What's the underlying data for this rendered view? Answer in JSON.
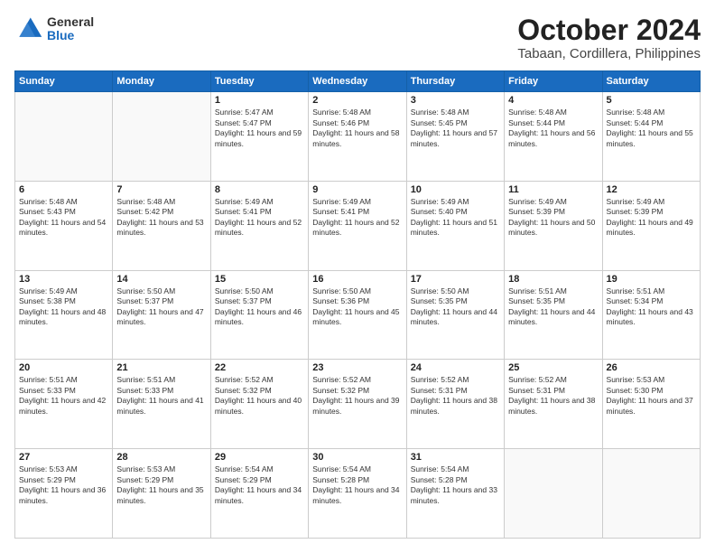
{
  "header": {
    "logo_general": "General",
    "logo_blue": "Blue",
    "month": "October 2024",
    "location": "Tabaan, Cordillera, Philippines"
  },
  "weekdays": [
    "Sunday",
    "Monday",
    "Tuesday",
    "Wednesday",
    "Thursday",
    "Friday",
    "Saturday"
  ],
  "weeks": [
    [
      {
        "day": "",
        "info": ""
      },
      {
        "day": "",
        "info": ""
      },
      {
        "day": "1",
        "info": "Sunrise: 5:47 AM\nSunset: 5:47 PM\nDaylight: 11 hours and 59 minutes."
      },
      {
        "day": "2",
        "info": "Sunrise: 5:48 AM\nSunset: 5:46 PM\nDaylight: 11 hours and 58 minutes."
      },
      {
        "day": "3",
        "info": "Sunrise: 5:48 AM\nSunset: 5:45 PM\nDaylight: 11 hours and 57 minutes."
      },
      {
        "day": "4",
        "info": "Sunrise: 5:48 AM\nSunset: 5:44 PM\nDaylight: 11 hours and 56 minutes."
      },
      {
        "day": "5",
        "info": "Sunrise: 5:48 AM\nSunset: 5:44 PM\nDaylight: 11 hours and 55 minutes."
      }
    ],
    [
      {
        "day": "6",
        "info": "Sunrise: 5:48 AM\nSunset: 5:43 PM\nDaylight: 11 hours and 54 minutes."
      },
      {
        "day": "7",
        "info": "Sunrise: 5:48 AM\nSunset: 5:42 PM\nDaylight: 11 hours and 53 minutes."
      },
      {
        "day": "8",
        "info": "Sunrise: 5:49 AM\nSunset: 5:41 PM\nDaylight: 11 hours and 52 minutes."
      },
      {
        "day": "9",
        "info": "Sunrise: 5:49 AM\nSunset: 5:41 PM\nDaylight: 11 hours and 52 minutes."
      },
      {
        "day": "10",
        "info": "Sunrise: 5:49 AM\nSunset: 5:40 PM\nDaylight: 11 hours and 51 minutes."
      },
      {
        "day": "11",
        "info": "Sunrise: 5:49 AM\nSunset: 5:39 PM\nDaylight: 11 hours and 50 minutes."
      },
      {
        "day": "12",
        "info": "Sunrise: 5:49 AM\nSunset: 5:39 PM\nDaylight: 11 hours and 49 minutes."
      }
    ],
    [
      {
        "day": "13",
        "info": "Sunrise: 5:49 AM\nSunset: 5:38 PM\nDaylight: 11 hours and 48 minutes."
      },
      {
        "day": "14",
        "info": "Sunrise: 5:50 AM\nSunset: 5:37 PM\nDaylight: 11 hours and 47 minutes."
      },
      {
        "day": "15",
        "info": "Sunrise: 5:50 AM\nSunset: 5:37 PM\nDaylight: 11 hours and 46 minutes."
      },
      {
        "day": "16",
        "info": "Sunrise: 5:50 AM\nSunset: 5:36 PM\nDaylight: 11 hours and 45 minutes."
      },
      {
        "day": "17",
        "info": "Sunrise: 5:50 AM\nSunset: 5:35 PM\nDaylight: 11 hours and 44 minutes."
      },
      {
        "day": "18",
        "info": "Sunrise: 5:51 AM\nSunset: 5:35 PM\nDaylight: 11 hours and 44 minutes."
      },
      {
        "day": "19",
        "info": "Sunrise: 5:51 AM\nSunset: 5:34 PM\nDaylight: 11 hours and 43 minutes."
      }
    ],
    [
      {
        "day": "20",
        "info": "Sunrise: 5:51 AM\nSunset: 5:33 PM\nDaylight: 11 hours and 42 minutes."
      },
      {
        "day": "21",
        "info": "Sunrise: 5:51 AM\nSunset: 5:33 PM\nDaylight: 11 hours and 41 minutes."
      },
      {
        "day": "22",
        "info": "Sunrise: 5:52 AM\nSunset: 5:32 PM\nDaylight: 11 hours and 40 minutes."
      },
      {
        "day": "23",
        "info": "Sunrise: 5:52 AM\nSunset: 5:32 PM\nDaylight: 11 hours and 39 minutes."
      },
      {
        "day": "24",
        "info": "Sunrise: 5:52 AM\nSunset: 5:31 PM\nDaylight: 11 hours and 38 minutes."
      },
      {
        "day": "25",
        "info": "Sunrise: 5:52 AM\nSunset: 5:31 PM\nDaylight: 11 hours and 38 minutes."
      },
      {
        "day": "26",
        "info": "Sunrise: 5:53 AM\nSunset: 5:30 PM\nDaylight: 11 hours and 37 minutes."
      }
    ],
    [
      {
        "day": "27",
        "info": "Sunrise: 5:53 AM\nSunset: 5:29 PM\nDaylight: 11 hours and 36 minutes."
      },
      {
        "day": "28",
        "info": "Sunrise: 5:53 AM\nSunset: 5:29 PM\nDaylight: 11 hours and 35 minutes."
      },
      {
        "day": "29",
        "info": "Sunrise: 5:54 AM\nSunset: 5:29 PM\nDaylight: 11 hours and 34 minutes."
      },
      {
        "day": "30",
        "info": "Sunrise: 5:54 AM\nSunset: 5:28 PM\nDaylight: 11 hours and 34 minutes."
      },
      {
        "day": "31",
        "info": "Sunrise: 5:54 AM\nSunset: 5:28 PM\nDaylight: 11 hours and 33 minutes."
      },
      {
        "day": "",
        "info": ""
      },
      {
        "day": "",
        "info": ""
      }
    ]
  ]
}
